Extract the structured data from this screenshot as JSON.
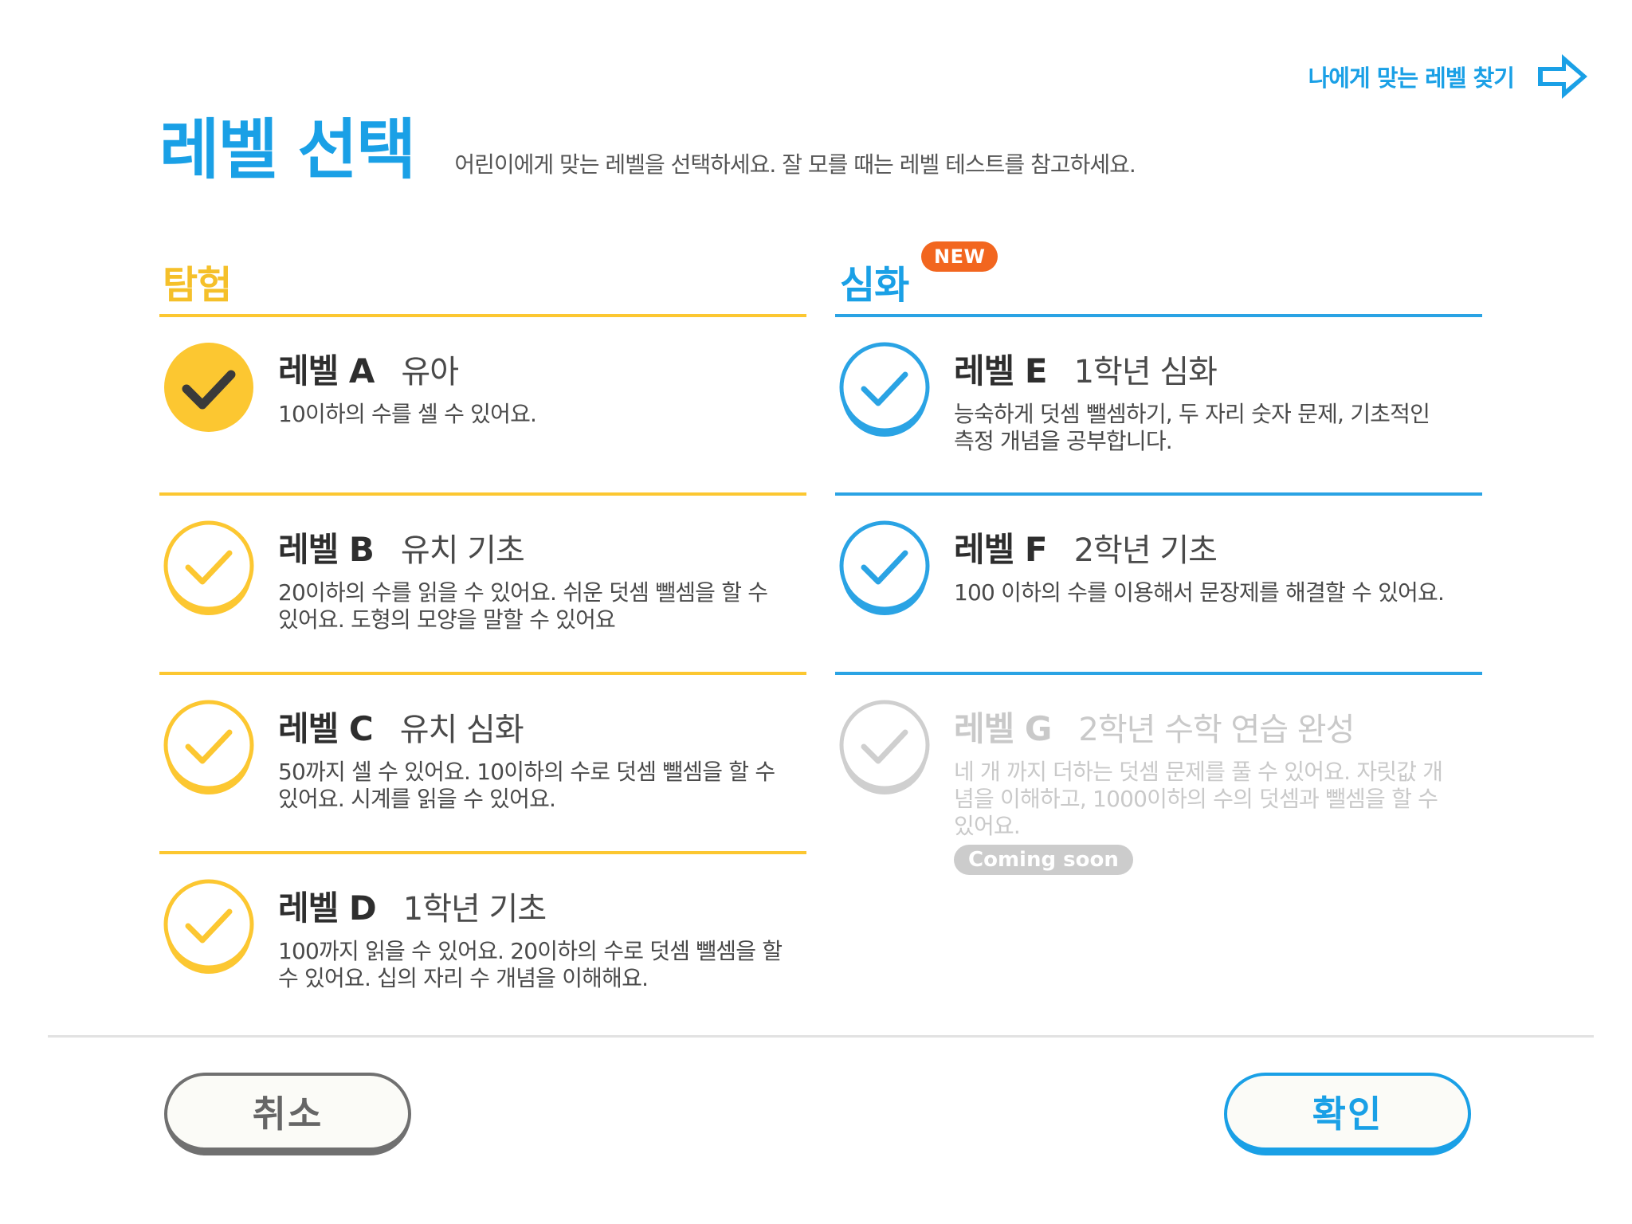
{
  "top_link": {
    "label": "나에게 맞는 레벨 찾기",
    "icon": "arrow-right-icon"
  },
  "header": {
    "title": "레벨 선택",
    "subtitle": "어린이에게 맞는 레벨을 선택하세요. 잘 모를 때는 레벨 테스트를 참고하세요."
  },
  "columns": {
    "left": {
      "title": "탐험"
    },
    "right": {
      "title": "심화",
      "badge": "NEW"
    }
  },
  "levels": [
    {
      "name": "레벨 A",
      "grade": "유아",
      "desc_lines": [
        "10이하의 수를 셀 수 있어요."
      ],
      "state": "selected"
    },
    {
      "name": "레벨 B",
      "grade": "유치 기초",
      "desc_lines": [
        "20이하의 수를 읽을 수 있어요. 쉬운 덧셈 뺄셈을 할 수",
        "있어요. 도형의 모양을 말할 수 있어요"
      ],
      "state": "available"
    },
    {
      "name": "레벨 C",
      "grade": "유치 심화",
      "desc_lines": [
        "50까지 셀 수 있어요. 10이하의 수로 덧셈 뺄셈을 할 수",
        "있어요. 시계를 읽을 수 있어요."
      ],
      "state": "available"
    },
    {
      "name": "레벨 D",
      "grade": "1학년 기초",
      "desc_lines": [
        "100까지 읽을 수 있어요. 20이하의 수로 덧셈 뺄셈을 할",
        "수 있어요. 십의 자리 수 개념을 이해해요."
      ],
      "state": "available"
    },
    {
      "name": "레벨 E",
      "grade": "1학년 심화",
      "desc_lines": [
        "능숙하게 덧셈 뺄셈하기, 두 자리 숫자 문제, 기초적인",
        "측정 개념을 공부합니다."
      ],
      "state": "available"
    },
    {
      "name": "레벨 F",
      "grade": "2학년 기초",
      "desc_lines": [
        "100 이하의 수를 이용해서 문장제를 해결할 수 있어요."
      ],
      "state": "available"
    },
    {
      "name": "레벨 G",
      "grade": "2학년 수학 연습 완성",
      "desc_lines": [
        "네 개 까지 더하는 덧셈 문제를 풀 수 있어요. 자릿값 개",
        "념을 이해하고, 1000이하의 수의 덧셈과 뺄셈을 할 수",
        "있어요."
      ],
      "state": "disabled",
      "tag": "Coming soon"
    }
  ],
  "colors": {
    "yellow": "#fcc731",
    "blue": "#1aa0e6",
    "orange": "#f2661f",
    "disabled": "#cccccc"
  },
  "buttons": {
    "cancel": "취소",
    "confirm": "확인"
  }
}
